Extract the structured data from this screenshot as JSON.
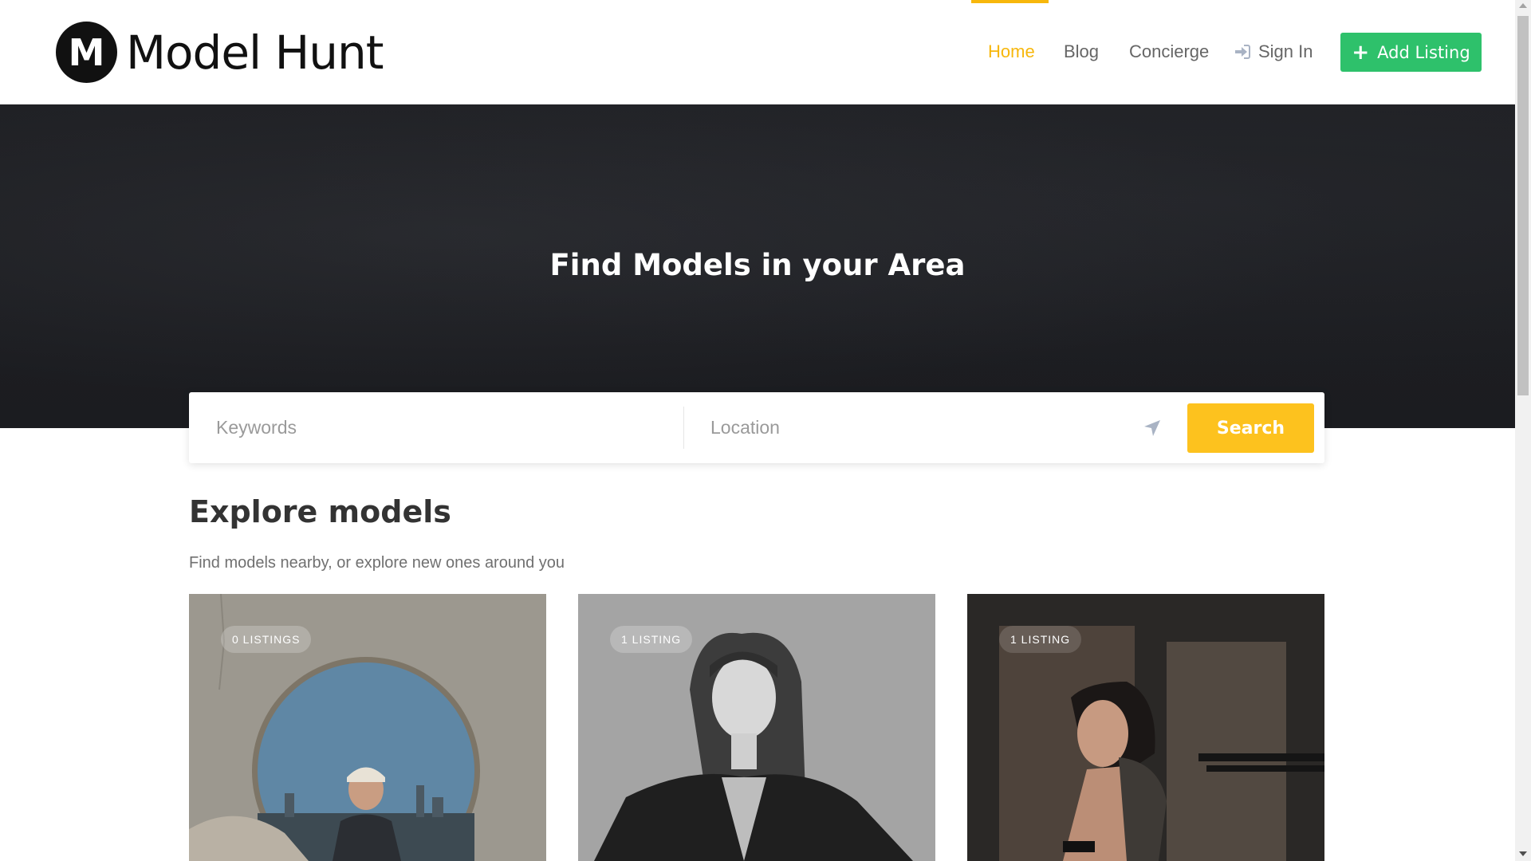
{
  "brand": {
    "logo_letter": "M",
    "name": "Model Hunt"
  },
  "nav": {
    "home": "Home",
    "blog": "Blog",
    "concierge": "Concierge",
    "sign_in": "Sign In",
    "add_listing": "Add Listing",
    "active_color": "#f7b70c"
  },
  "hero": {
    "title": "Find Models in your Area"
  },
  "search": {
    "keywords_placeholder": "Keywords",
    "location_placeholder": "Location",
    "button_label": "Search",
    "button_color": "#fdc21e"
  },
  "explore": {
    "title": "Explore models",
    "subtitle": "Find models nearby, or explore new ones around you",
    "cards": [
      {
        "badge": "0 LISTINGS"
      },
      {
        "badge": "1 LISTING"
      },
      {
        "badge": "1 LISTING"
      }
    ]
  },
  "colors": {
    "add_listing": "#2ec16b",
    "hero_bg": "#1d1e22"
  }
}
